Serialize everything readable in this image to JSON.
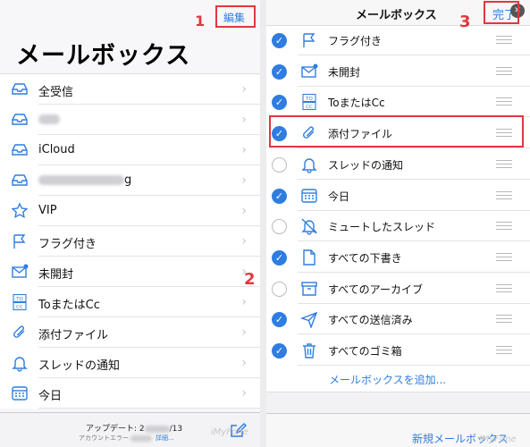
{
  "left": {
    "edit_label": "編集",
    "title": "メールボックス",
    "items": [
      {
        "label": "全受信",
        "icon": "inbox-icon"
      },
      {
        "label": "",
        "icon": "inbox-icon",
        "blurred": true
      },
      {
        "label": "iCloud",
        "icon": "inbox-icon"
      },
      {
        "label": "g",
        "icon": "inbox-icon",
        "blurred": true
      },
      {
        "label": "VIP",
        "icon": "star-icon"
      },
      {
        "label": "フラグ付き",
        "icon": "flag-icon"
      },
      {
        "label": "未開封",
        "icon": "unread-mail-icon"
      },
      {
        "label": "ToまたはCc",
        "icon": "to-cc-icon"
      },
      {
        "label": "添付ファイル",
        "icon": "paperclip-icon"
      },
      {
        "label": "スレッドの通知",
        "icon": "bell-icon"
      },
      {
        "label": "今日",
        "icon": "calendar-icon"
      }
    ],
    "update_text": "アップデート: 2",
    "update_suffix": "/13",
    "account_error": "アカウントエラー",
    "details": "詳細..."
  },
  "right": {
    "title": "メールボックス",
    "done_label": "完了",
    "items": [
      {
        "label": "フラグ付き",
        "checked": true,
        "icon": "flag-icon"
      },
      {
        "label": "未開封",
        "checked": true,
        "icon": "unread-mail-icon"
      },
      {
        "label": "ToまたはCc",
        "checked": true,
        "icon": "to-cc-icon"
      },
      {
        "label": "添付ファイル",
        "checked": true,
        "icon": "paperclip-icon"
      },
      {
        "label": "スレッドの通知",
        "checked": false,
        "icon": "bell-icon"
      },
      {
        "label": "今日",
        "checked": true,
        "icon": "calendar-icon"
      },
      {
        "label": "ミュートしたスレッド",
        "checked": false,
        "icon": "muted-bell-icon"
      },
      {
        "label": "すべての下書き",
        "checked": true,
        "icon": "document-icon"
      },
      {
        "label": "すべてのアーカイブ",
        "checked": false,
        "icon": "archive-box-icon"
      },
      {
        "label": "すべての送信済み",
        "checked": true,
        "icon": "paper-plane-icon"
      },
      {
        "label": "すべてのゴミ箱",
        "checked": true,
        "icon": "trash-icon"
      }
    ],
    "add_mailbox": "メールボックスを追加...",
    "new_mailbox": "新規メールボックス"
  },
  "annotations": {
    "step1": "1",
    "step2": "2",
    "step3": "3"
  },
  "watermark": "iMyFone",
  "colors": {
    "accent": "#2f7de1",
    "annotation": "#e0383e"
  }
}
